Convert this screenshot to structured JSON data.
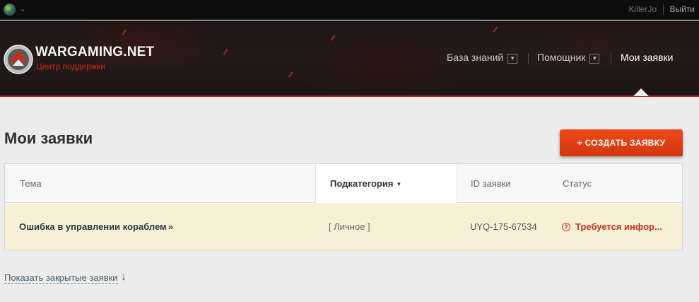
{
  "topbar": {
    "user_name": "KillerJo",
    "logout_label": "Выйти"
  },
  "header": {
    "logo_text": "WARGAMING.NET",
    "logo_subtitle": "Центр поддержки",
    "nav": [
      {
        "label": "База знаний",
        "has_dropdown": true
      },
      {
        "label": "Помощник",
        "has_dropdown": true
      },
      {
        "label": "Мои заявки",
        "has_dropdown": false,
        "active": true
      }
    ]
  },
  "main": {
    "title": "Мои заявки",
    "create_button_label": "+ СОЗДАТЬ ЗАЯВКУ",
    "table": {
      "columns": [
        "Тема",
        "Подкатегория",
        "ID заявки",
        "Статус"
      ],
      "sorted_column": "Подкатегория",
      "rows": [
        {
          "topic": "Ошибка в управлении кораблем",
          "subcategory": "[ Личное ]",
          "ticket_id": "UYQ-175-67534",
          "status": "Требуется инфор..."
        }
      ]
    },
    "show_closed_label": "Показать закрытые заявки"
  },
  "colors": {
    "accent": "#d23510",
    "status_attention": "#c8321a",
    "row_highlight": "#f6f1d6"
  }
}
